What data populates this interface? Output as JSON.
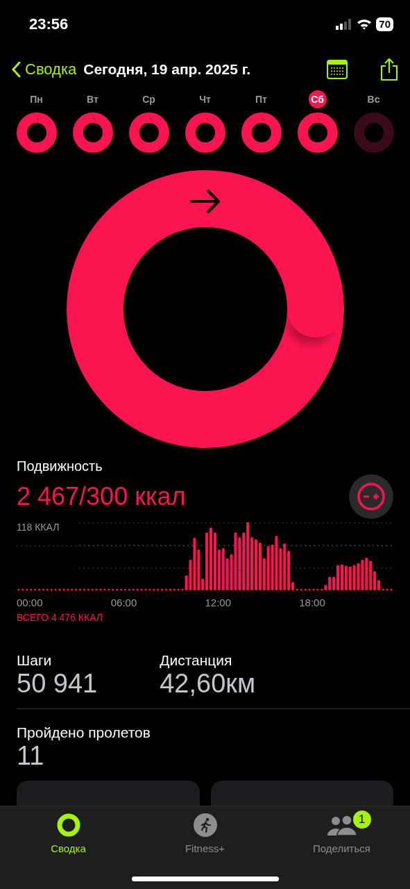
{
  "status_bar": {
    "time": "23:56",
    "battery": "70"
  },
  "nav": {
    "back": "Сводка",
    "title": "Сегодня, 19 апр. 2025 г."
  },
  "days": [
    {
      "label": "Пн",
      "selected": false,
      "closed": true
    },
    {
      "label": "Вт",
      "selected": false,
      "closed": true
    },
    {
      "label": "Ср",
      "selected": false,
      "closed": true
    },
    {
      "label": "Чт",
      "selected": false,
      "closed": true
    },
    {
      "label": "Пт",
      "selected": false,
      "closed": true
    },
    {
      "label": "Сб",
      "selected": true,
      "closed": true
    },
    {
      "label": "Вс",
      "selected": false,
      "closed": false
    }
  ],
  "move": {
    "title": "Подвижность",
    "value": "2 467/300 ккал",
    "top_label": "118 ККАЛ",
    "times": [
      "00:00",
      "06:00",
      "12:00",
      "18:00"
    ],
    "total": "ВСЕГО 4 476 ККАЛ"
  },
  "stats": [
    {
      "label": "Шаги",
      "value": "50 941"
    },
    {
      "label": "Дистанция",
      "value": "42,60км"
    }
  ],
  "flights": {
    "label": "Пройдено пролетов",
    "value": "11"
  },
  "tabs": [
    {
      "label": "Сводка",
      "selected": true,
      "kind": "rings"
    },
    {
      "label": "Fitness+",
      "selected": false,
      "kind": "runner"
    },
    {
      "label": "Поделиться",
      "selected": false,
      "kind": "people",
      "badge": "1"
    }
  ]
}
